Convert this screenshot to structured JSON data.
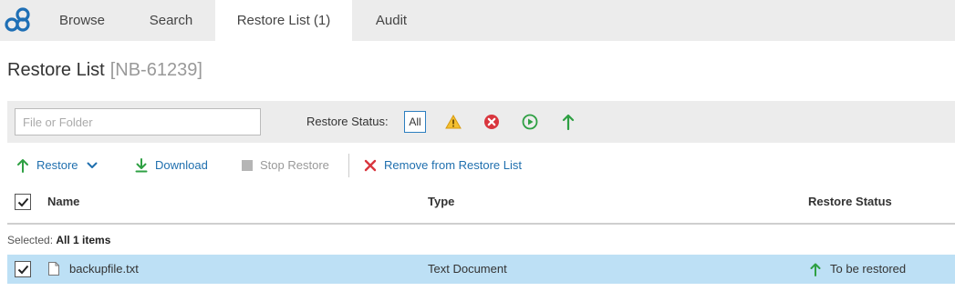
{
  "app": {
    "logo_icon": "app-logo-icon",
    "accent_color": "#1e6fb5"
  },
  "nav": {
    "tabs": [
      {
        "label": "Browse",
        "active": false
      },
      {
        "label": "Search",
        "active": false
      },
      {
        "label": "Restore List (1)",
        "active": true
      },
      {
        "label": "Audit",
        "active": false
      }
    ]
  },
  "page": {
    "title": "Restore List",
    "id_label": "[NB-61239]"
  },
  "filter": {
    "placeholder": "File or Folder",
    "value": "",
    "status_label": "Restore Status:",
    "status_buttons": [
      {
        "label": "All",
        "icon": "all",
        "selected": true
      },
      {
        "label": "",
        "icon": "warning-icon",
        "color": "#e8a317"
      },
      {
        "label": "",
        "icon": "error-icon",
        "color": "#d9363e"
      },
      {
        "label": "",
        "icon": "play-icon",
        "color": "#2ea043"
      },
      {
        "label": "",
        "icon": "arrow-up-icon",
        "color": "#2ea043"
      }
    ]
  },
  "toolbar": {
    "restore_label": "Restore",
    "download_label": "Download",
    "stop_label": "Stop Restore",
    "remove_label": "Remove from Restore List"
  },
  "table": {
    "columns": [
      "Name",
      "Type",
      "Restore Status"
    ],
    "selection": {
      "prefix": "Selected: ",
      "value": "All 1 items"
    },
    "rows": [
      {
        "name": "backupfile.txt",
        "type": "Text Document",
        "status": "To be restored",
        "checked": true
      }
    ]
  }
}
